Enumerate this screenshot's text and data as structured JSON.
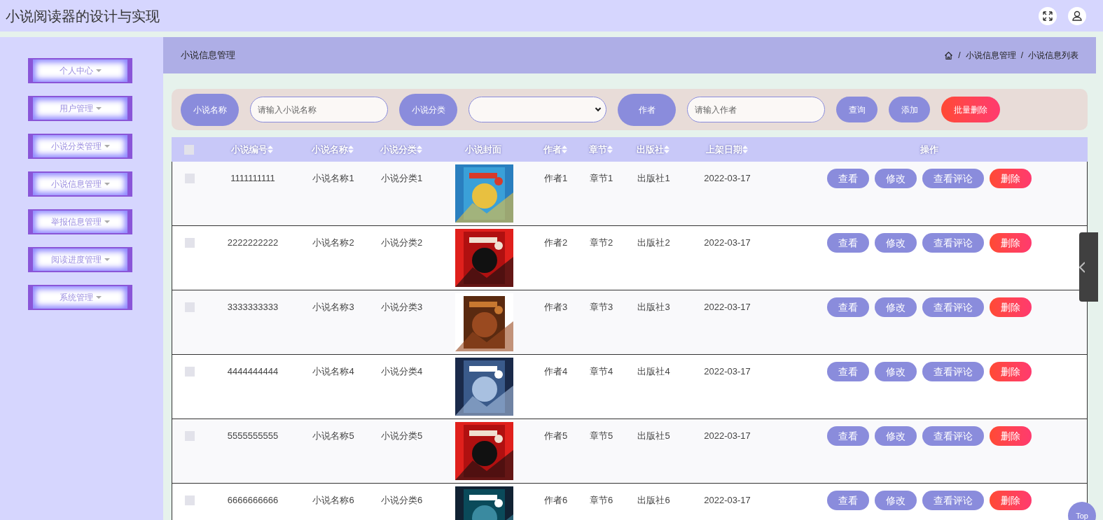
{
  "app_title": "小说阅读器的设计与实现",
  "sidebar": {
    "items": [
      {
        "label": "个人中心"
      },
      {
        "label": "用户管理"
      },
      {
        "label": "小说分类管理"
      },
      {
        "label": "小说信息管理"
      },
      {
        "label": "举报信息管理"
      },
      {
        "label": "阅读进度管理"
      },
      {
        "label": "系统管理"
      }
    ]
  },
  "breadcrumb": {
    "title": "小说信息管理",
    "separator": "/",
    "path": [
      "小说信息管理",
      "小说信息列表"
    ]
  },
  "search": {
    "fields": [
      {
        "kind": "text",
        "label": "小说名称",
        "placeholder": "请输入小说名称"
      },
      {
        "kind": "select",
        "label": "小说分类"
      },
      {
        "kind": "text",
        "label": "作者",
        "placeholder": "请输入作者"
      }
    ],
    "buttons": [
      {
        "label": "查询",
        "kind": "primary"
      },
      {
        "label": "添加",
        "kind": "primary"
      },
      {
        "label": "批量删除",
        "kind": "danger"
      }
    ]
  },
  "table": {
    "header_checked": false,
    "columns": [
      {
        "label": "小说编号",
        "sortable": true
      },
      {
        "label": "小说名称",
        "sortable": true
      },
      {
        "label": "小说分类",
        "sortable": true
      },
      {
        "label": "小说封面",
        "sortable": false
      },
      {
        "label": "作者",
        "sortable": true
      },
      {
        "label": "章节",
        "sortable": true
      },
      {
        "label": "出版社",
        "sortable": true
      },
      {
        "label": "上架日期",
        "sortable": true
      },
      {
        "label": "操作",
        "sortable": false
      }
    ],
    "rows": [
      {
        "checked": false,
        "id": "1111111111",
        "name": "小说名称1",
        "category": "小说分类1",
        "author": "作者1",
        "chapter": "章节1",
        "publisher": "出版社1",
        "date": "2022-03-17",
        "actions": [
          {
            "label": "查看",
            "kind": "primary"
          },
          {
            "label": "修改",
            "kind": "primary"
          },
          {
            "label": "查看评论",
            "kind": "primary"
          },
          {
            "label": "删除",
            "kind": "danger"
          }
        ]
      },
      {
        "checked": false,
        "id": "2222222222",
        "name": "小说名称2",
        "category": "小说分类2",
        "author": "作者2",
        "chapter": "章节2",
        "publisher": "出版社2",
        "date": "2022-03-17",
        "actions": [
          {
            "label": "查看",
            "kind": "primary"
          },
          {
            "label": "修改",
            "kind": "primary"
          },
          {
            "label": "查看评论",
            "kind": "primary"
          },
          {
            "label": "删除",
            "kind": "danger"
          }
        ]
      },
      {
        "checked": false,
        "id": "3333333333",
        "name": "小说名称3",
        "category": "小说分类3",
        "author": "作者3",
        "chapter": "章节3",
        "publisher": "出版社3",
        "date": "2022-03-17",
        "actions": [
          {
            "label": "查看",
            "kind": "primary"
          },
          {
            "label": "修改",
            "kind": "primary"
          },
          {
            "label": "查看评论",
            "kind": "primary"
          },
          {
            "label": "删除",
            "kind": "danger"
          }
        ]
      },
      {
        "checked": false,
        "id": "4444444444",
        "name": "小说名称4",
        "category": "小说分类4",
        "author": "作者4",
        "chapter": "章节4",
        "publisher": "出版社4",
        "date": "2022-03-17",
        "actions": [
          {
            "label": "查看",
            "kind": "primary"
          },
          {
            "label": "修改",
            "kind": "primary"
          },
          {
            "label": "查看评论",
            "kind": "primary"
          },
          {
            "label": "删除",
            "kind": "danger"
          }
        ]
      },
      {
        "checked": false,
        "id": "5555555555",
        "name": "小说名称5",
        "category": "小说分类5",
        "author": "作者5",
        "chapter": "章节5",
        "publisher": "出版社5",
        "date": "2022-03-17",
        "actions": [
          {
            "label": "查看",
            "kind": "primary"
          },
          {
            "label": "修改",
            "kind": "primary"
          },
          {
            "label": "查看评论",
            "kind": "primary"
          },
          {
            "label": "删除",
            "kind": "danger"
          }
        ]
      },
      {
        "checked": false,
        "id": "6666666666",
        "name": "小说名称6",
        "category": "小说分类6",
        "author": "作者6",
        "chapter": "章节6",
        "publisher": "出版社6",
        "date": "2022-03-17",
        "actions": [
          {
            "label": "查看",
            "kind": "primary"
          },
          {
            "label": "修改",
            "kind": "primary"
          },
          {
            "label": "查看评论",
            "kind": "primary"
          },
          {
            "label": "删除",
            "kind": "danger"
          }
        ]
      }
    ]
  },
  "back_to_top": "Top"
}
